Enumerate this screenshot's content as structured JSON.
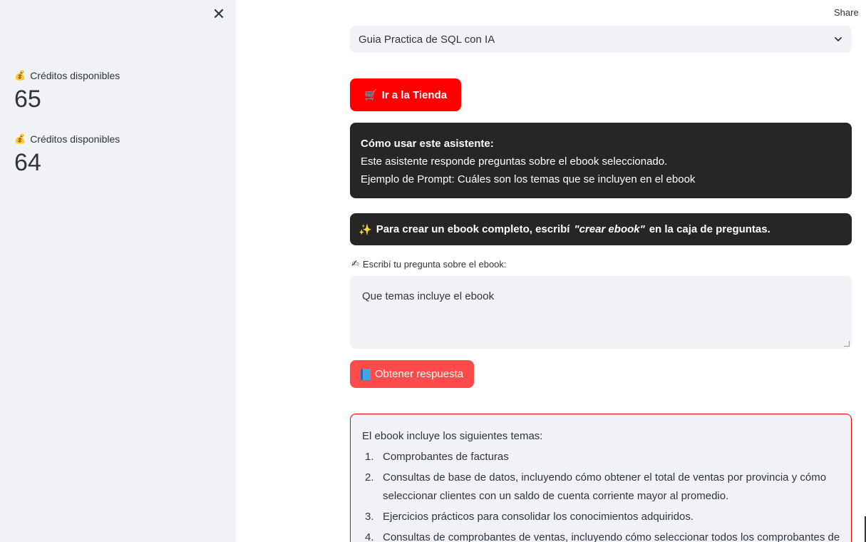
{
  "sidebar": {
    "metrics": [
      {
        "label": "Créditos disponibles",
        "value": "65"
      },
      {
        "label": "Créditos disponibles",
        "value": "64"
      }
    ]
  },
  "header": {
    "share_label": "Share"
  },
  "main": {
    "ebook_select": {
      "value": "Guia Practica de SQL con IA"
    },
    "store_button": {
      "label": "Ir a la Tienda"
    },
    "info": {
      "title": "Cómo usar este asistente:",
      "line1": "Este asistente responde preguntas sobre el ebook seleccionado.",
      "line2": "Ejemplo de Prompt: Cuáles son los temas que se incluyen en el ebook"
    },
    "tip": {
      "before": "Para crear un ebook completo, escribí",
      "keyword": "\"crear ebook\"",
      "after": "en la caja de preguntas."
    },
    "question": {
      "label": "Escribí tu pregunta sobre el ebook:",
      "value": "Que temas incluye el ebook"
    },
    "answer_button": {
      "label": "Obtener respuesta"
    },
    "answer": {
      "intro": "El ebook incluye los siguientes temas:",
      "items": [
        {
          "num": "1.",
          "text": "Comprobantes de facturas"
        },
        {
          "num": "2.",
          "text": "Consultas de base de datos, incluyendo cómo obtener el total de ventas por provincia y cómo seleccionar clientes con un saldo de cuenta corriente mayor al promedio."
        },
        {
          "num": "3.",
          "text": "Ejercicios prácticos para consolidar los conocimientos adquiridos."
        },
        {
          "num": "4.",
          "text": "Consultas de comprobantes de ventas, incluyendo cómo seleccionar todos los comprobantes de"
        }
      ]
    }
  },
  "icons": {
    "close": "close-icon",
    "money": "money-bag-icon",
    "chevron": "chevron-down-icon",
    "store": "shopping-cart-icon",
    "sparkles": "sparkles-icon",
    "writing": "writing-hand-icon",
    "book": "book-icon"
  },
  "colors": {
    "sidebar_bg": "#f0f2f6",
    "store_button": "#ff0000",
    "answer_button": "#ff4b4b",
    "dark_box": "#262626",
    "answer_border": "#e00000"
  }
}
